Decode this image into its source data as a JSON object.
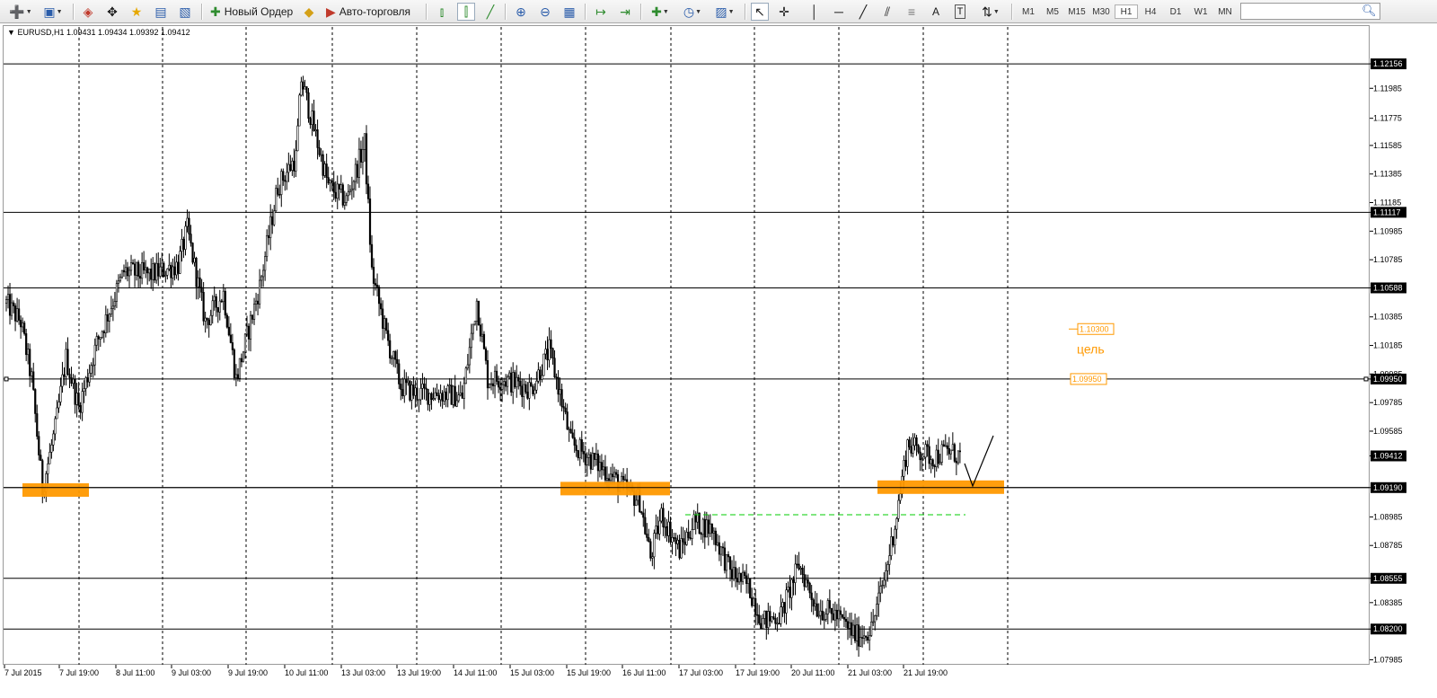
{
  "toolbar": {
    "new_order_label": "Новый Ордер",
    "auto_trading_label": "Авто-торговля",
    "timeframes": [
      "M1",
      "M5",
      "M15",
      "M30",
      "H1",
      "H4",
      "D1",
      "W1",
      "MN"
    ],
    "active_timeframe": "H1",
    "search_placeholder": ""
  },
  "icons": {
    "new_chart": "new-chart-icon",
    "profiles": "profiles-icon",
    "market_watch": "market-watch-icon",
    "navigator": "navigator-icon",
    "favorites": "favorites-icon",
    "terminal": "terminal-icon",
    "tester": "tester-icon",
    "new_order": "new-order-icon",
    "metaeditor": "metaeditor-icon",
    "auto_trading": "auto-trading-icon",
    "bar_chart": "bar-chart-icon",
    "candlesticks": "candlesticks-icon",
    "line_chart": "line-chart-icon",
    "zoom_in": "zoom-in-icon",
    "zoom_out": "zoom-out-icon",
    "tile_windows": "tile-windows-icon",
    "chart_shift": "chart-shift-icon",
    "auto_scroll": "auto-scroll-icon",
    "indicators": "indicators-icon",
    "periods": "periods-icon",
    "templates": "templates-icon",
    "cursor": "cursor-icon",
    "crosshair": "crosshair-icon",
    "vertical_line": "vertical-line-icon",
    "horizontal_line": "horizontal-line-icon",
    "trendline": "trendline-icon",
    "equidistant_channel": "equidistant-channel-icon",
    "fibonacci": "fibonacci-icon",
    "text": "text-icon",
    "text_label": "text-label-icon",
    "arrows": "arrows-icon",
    "search": "search-icon"
  },
  "chart_data": {
    "type": "candlestick",
    "symbol_header": "EURUSD,H1  1.09431 1.09434 1.09392 1.09412",
    "ylim": [
      1.0795,
      1.1232
    ],
    "y_ticks": [
      "1.12156",
      "1.11985",
      "1.11775",
      "1.11585",
      "1.11385",
      "1.11185",
      "1.11117",
      "1.10985",
      "1.10785",
      "1.10588",
      "1.10385",
      "1.10185",
      "1.09985",
      "1.09950",
      "1.09785",
      "1.09585",
      "1.09412",
      "1.09190",
      "1.08985",
      "1.08785",
      "1.08555",
      "1.08385",
      "1.08200",
      "1.07985"
    ],
    "y_tick_values": [
      1.12156,
      1.11985,
      1.11775,
      1.11585,
      1.11385,
      1.11185,
      1.11117,
      1.10985,
      1.10785,
      1.10588,
      1.10385,
      1.10185,
      1.09985,
      1.0995,
      1.09785,
      1.09585,
      1.09412,
      1.0919,
      1.08985,
      1.08785,
      1.08555,
      1.08385,
      1.082,
      1.07985
    ],
    "highlighted_ticks": [
      "1.12156",
      "1.11117",
      "1.10588",
      "1.09950",
      "1.09412",
      "1.09190",
      "1.08555",
      "1.08200"
    ],
    "x_ticks": [
      "7 Jul 2015",
      "7 Jul 19:00",
      "8 Jul 11:00",
      "9 Jul 03:00",
      "9 Jul 19:00",
      "10 Jul 11:00",
      "13 Jul 03:00",
      "13 Jul 19:00",
      "14 Jul 11:00",
      "15 Jul 03:00",
      "15 Jul 19:00",
      "16 Jul 11:00",
      "17 Jul 03:00",
      "17 Jul 19:00",
      "20 Jul 11:00",
      "21 Jul 03:00",
      "21 Jul 19:00"
    ],
    "horizontal_levels": [
      1.12156,
      1.11117,
      1.10588,
      1.0995,
      1.0919,
      1.08555,
      1.082
    ],
    "price_anchors": [
      [
        0,
        1.1048
      ],
      [
        8,
        1.1035
      ],
      [
        14,
        1.0995
      ],
      [
        20,
        1.0918
      ],
      [
        27,
        1.096
      ],
      [
        33,
        1.101
      ],
      [
        40,
        1.0975
      ],
      [
        50,
        1.102
      ],
      [
        65,
        1.107
      ],
      [
        80,
        1.1068
      ],
      [
        95,
        1.1075
      ],
      [
        100,
        1.11
      ],
      [
        110,
        1.1035
      ],
      [
        120,
        1.1055
      ],
      [
        127,
        1.0995
      ],
      [
        140,
        1.106
      ],
      [
        150,
        1.113
      ],
      [
        160,
        1.115
      ],
      [
        163,
        1.1205
      ],
      [
        170,
        1.117
      ],
      [
        178,
        1.113
      ],
      [
        188,
        1.112
      ],
      [
        198,
        1.116
      ],
      [
        202,
        1.107
      ],
      [
        210,
        1.1025
      ],
      [
        218,
        1.099
      ],
      [
        226,
        1.0985
      ],
      [
        240,
        1.0985
      ],
      [
        252,
        1.0982
      ],
      [
        260,
        1.105
      ],
      [
        266,
        1.0995
      ],
      [
        275,
        1.0995
      ],
      [
        290,
        1.0988
      ],
      [
        300,
        1.1015
      ],
      [
        305,
        1.099
      ],
      [
        312,
        1.095
      ],
      [
        322,
        1.094
      ],
      [
        332,
        1.093
      ],
      [
        340,
        1.092
      ],
      [
        350,
        1.091
      ],
      [
        356,
        1.087
      ],
      [
        362,
        1.09
      ],
      [
        372,
        1.0875
      ],
      [
        380,
        1.0895
      ],
      [
        390,
        1.089
      ],
      [
        400,
        1.086
      ],
      [
        410,
        1.085
      ],
      [
        418,
        1.0825
      ],
      [
        428,
        1.083
      ],
      [
        438,
        1.0865
      ],
      [
        448,
        1.0835
      ],
      [
        458,
        1.083
      ],
      [
        470,
        1.0815
      ],
      [
        478,
        1.082
      ],
      [
        486,
        1.086
      ],
      [
        492,
        1.09
      ],
      [
        498,
        1.095
      ],
      [
        504,
        1.0945
      ],
      [
        512,
        1.094
      ],
      [
        520,
        1.0945
      ],
      [
        527,
        1.0941
      ]
    ],
    "annotations": {
      "target_price": "1.10300",
      "target_text": "цель",
      "entry_price": "1.09950"
    },
    "support_zones": [
      {
        "price": 1.0917,
        "from": "7 Jul 2015",
        "to": "7 Jul 19:00"
      },
      {
        "price": 1.0918,
        "from": "15 Jul 03:00",
        "to": "16 Jul 11:00"
      },
      {
        "price": 1.0919,
        "from": "21 Jul 03:00",
        "to": "21 Jul 19:00"
      }
    ],
    "dashed_level": 1.09,
    "colors": {
      "zone": "#ff9900",
      "dashed": "#00cc00",
      "annotation": "#ff9900",
      "level_line": "#000000",
      "grid": "#000000"
    },
    "grid": true
  }
}
